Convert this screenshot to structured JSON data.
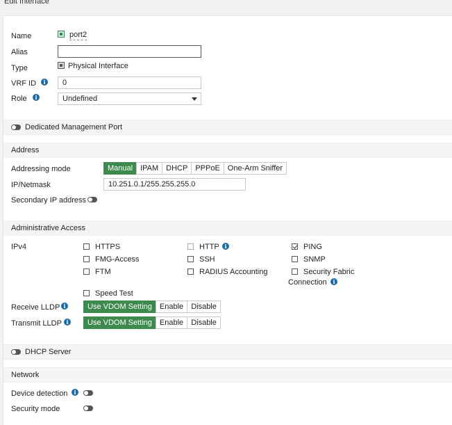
{
  "window": {
    "title": "Edit Interface"
  },
  "general": {
    "name_label": "Name",
    "name_value": "port2",
    "alias_label": "Alias",
    "alias_value": "",
    "type_label": "Type",
    "type_value": "Physical Interface",
    "vrf_label": "VRF ID",
    "vrf_value": "0",
    "role_label": "Role",
    "role_value": "Undefined"
  },
  "dedicated_mgmt": {
    "label": "Dedicated Management Port"
  },
  "address": {
    "section_title": "Address",
    "mode_label": "Addressing mode",
    "modes": [
      "Manual",
      "IPAM",
      "DHCP",
      "PPPoE",
      "One-Arm Sniffer"
    ],
    "active_mode": "Manual",
    "ip_label": "IP/Netmask",
    "ip_value": "10.251.0.1/255.255.255.0",
    "secondary_label": "Secondary IP address"
  },
  "admin": {
    "section_title": "Administrative Access",
    "ipv4_label": "IPv4",
    "https": "HTTPS",
    "http": "HTTP",
    "ping": "PING",
    "fmg": "FMG-Access",
    "ssh": "SSH",
    "snmp": "SNMP",
    "ftm": "FTM",
    "radius": "RADIUS Accounting",
    "fabric_line1": "Security Fabric",
    "fabric_line2": "Connection",
    "speed": "Speed Test",
    "rx_lldp_label": "Receive LLDP",
    "tx_lldp_label": "Transmit LLDP",
    "lldp_options": [
      "Use VDOM Setting",
      "Enable",
      "Disable"
    ]
  },
  "dhcp": {
    "label": "DHCP Server"
  },
  "network": {
    "section_title": "Network",
    "device_detection_label": "Device detection",
    "security_mode_label": "Security mode"
  },
  "colors": {
    "accent_green": "#3e8a4e",
    "info_blue": "#1a6aa8"
  }
}
